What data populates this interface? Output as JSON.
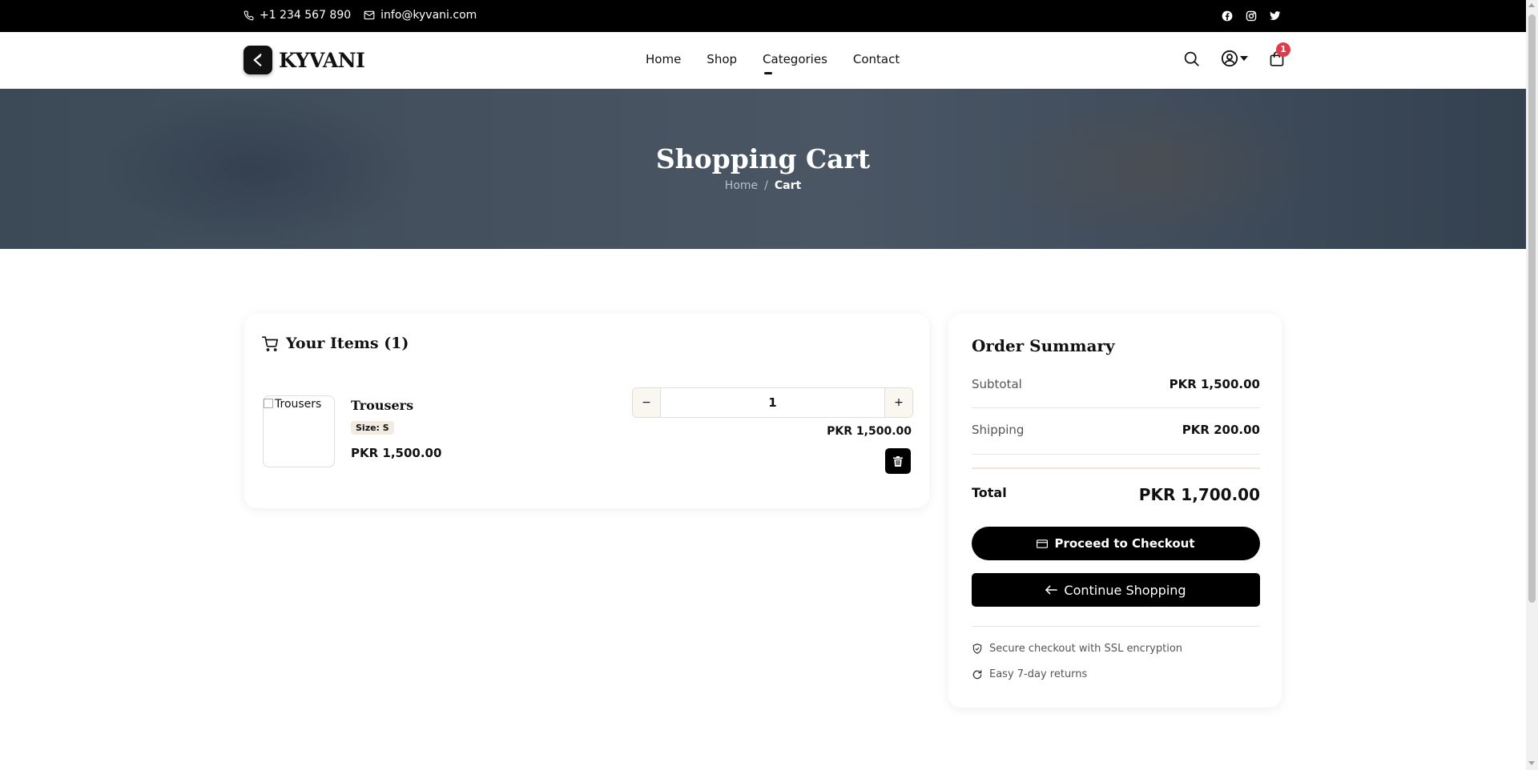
{
  "topbar": {
    "phone": "+1 234 567 890",
    "email": "info@kyvani.com",
    "social": [
      "facebook-icon",
      "instagram-icon",
      "twitter-icon"
    ]
  },
  "header": {
    "brand": "KYVANI",
    "logo_letter": "K",
    "nav": [
      "Home",
      "Shop",
      "Categories",
      "Contact"
    ],
    "active_nav": "Categories",
    "cart_count": "1"
  },
  "hero": {
    "title": "Shopping Cart",
    "breadcrumb": [
      "Home",
      "/",
      "Cart"
    ]
  },
  "cart": {
    "heading": "Your Items (1)",
    "item": {
      "image_alt": "Trousers",
      "name": "Trousers",
      "size": "Size: S",
      "price": "PKR 1,500.00",
      "quantity": "1",
      "minus": "−",
      "plus": "+",
      "line_total": "PKR 1,500.00"
    }
  },
  "summary": {
    "title": "Order Summary",
    "subtotal_label": "Subtotal",
    "subtotal": "PKR 1,500.00",
    "shipping_label": "Shipping",
    "shipping": "PKR 200.00",
    "total_label": "Total",
    "total": "PKR 1,700.00",
    "checkout_label": "Proceed to Checkout",
    "continue_label": "Continue Shopping",
    "secure_note": "Secure checkout with SSL encryption",
    "returns_note": "Easy 7-day returns"
  },
  "colors": {
    "accent": "#000000",
    "badge": "#e0394a",
    "hero_bg": "#44505e",
    "size_badge_bg": "#f1ebe1"
  }
}
